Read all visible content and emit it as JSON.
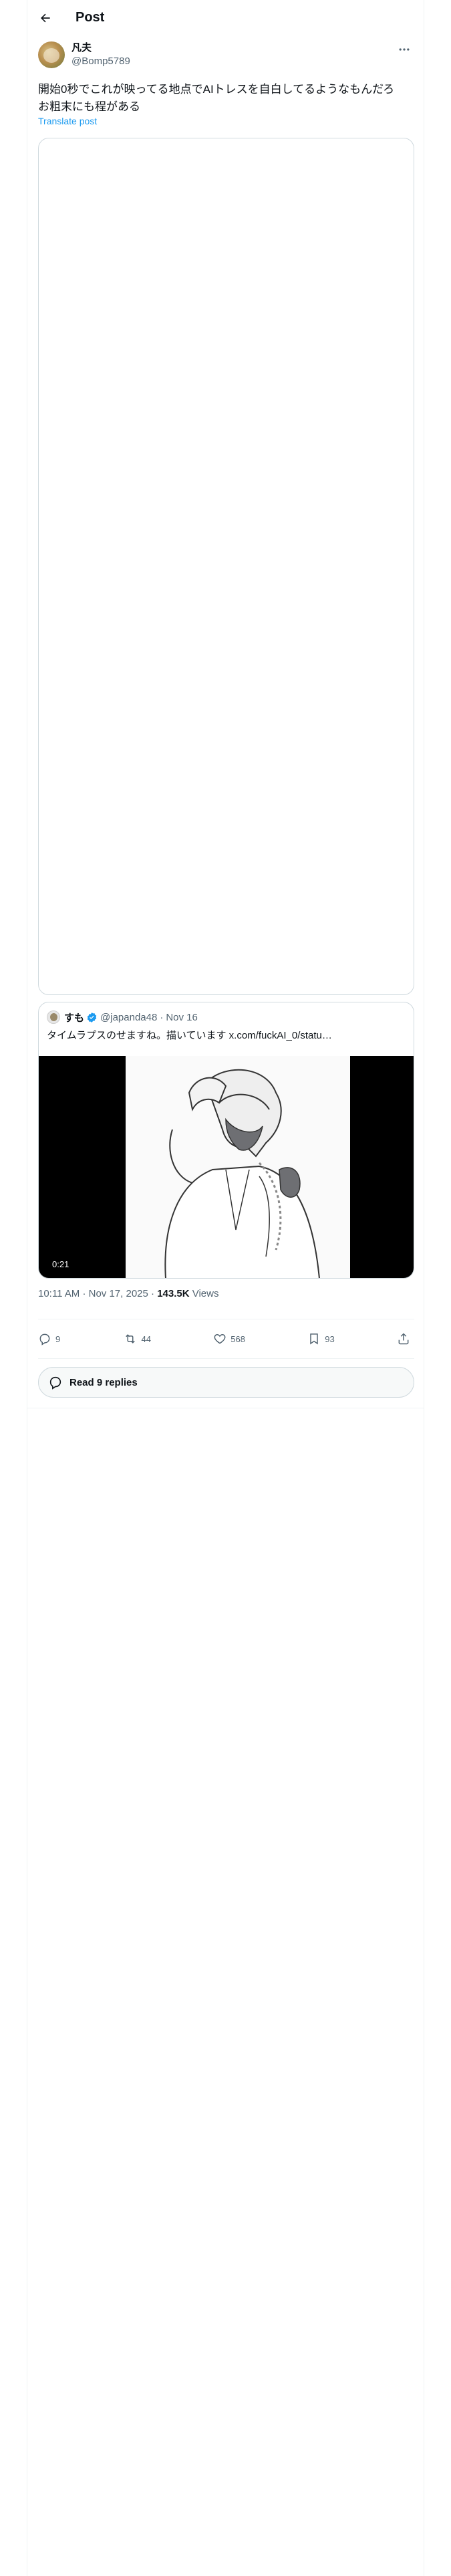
{
  "header": {
    "title": "Post"
  },
  "author": {
    "display_name": "凡夫",
    "handle": "@Bomp5789"
  },
  "tweet": {
    "text": "開始0秒でこれが映ってる地点でAIトレスを自白してるようなもんだろ\nお粗末にも程がある",
    "translate_label": "Translate post"
  },
  "quote": {
    "display_name": "すも",
    "handle": "@japanda48",
    "separator": "·",
    "date": "Nov 16",
    "text": "タイムラプスのせますね。描いています x.com/fuckAI_0/statu…",
    "duration": "0:21"
  },
  "meta": {
    "time": "10:11 AM",
    "dot1": "·",
    "date": "Nov 17, 2025",
    "dot2": "·",
    "views": "143.5K",
    "views_label": "Views"
  },
  "actions": {
    "replies": "9",
    "reposts": "44",
    "likes": "568",
    "bookmarks": "93"
  },
  "read_replies_label": "Read 9 replies",
  "colors": {
    "accent": "#1d9bf0",
    "text": "#0f1419",
    "secondary": "#536471",
    "border": "#cfd9de"
  }
}
